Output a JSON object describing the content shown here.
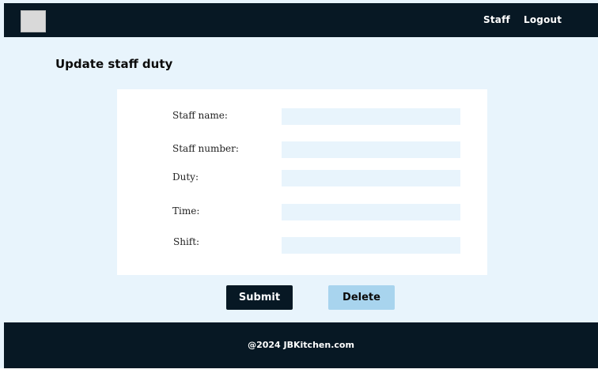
{
  "header": {
    "nav": {
      "staff": "Staff",
      "logout": "Logout"
    }
  },
  "main": {
    "title": "Update staff duty",
    "form": {
      "fields": [
        {
          "label": "Staff name:",
          "value": "",
          "placeholder": ""
        },
        {
          "label": "Staff number:",
          "value": "",
          "placeholder": ""
        },
        {
          "label": "Duty:",
          "value": "",
          "placeholder": ""
        },
        {
          "label": "Time:",
          "value": "",
          "placeholder": ""
        },
        {
          "label": "Shift:",
          "value": "",
          "placeholder": ""
        }
      ]
    },
    "buttons": {
      "submit": "Submit",
      "delete": "Delete"
    }
  },
  "footer": {
    "text": "@2024 JBKitchen.com"
  },
  "colors": {
    "dark": "#071824",
    "page_bg": "#e8f4fc",
    "delete_button": "#a8d4ee",
    "card": "#ffffff"
  }
}
